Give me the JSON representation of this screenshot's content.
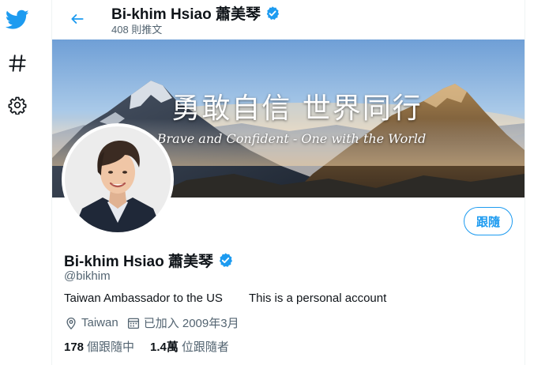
{
  "colors": {
    "accent": "#1d9bf0",
    "text": "#0f1419",
    "secondary": "#536471",
    "border": "#eff3f4"
  },
  "nav": {
    "items": [
      {
        "icon": "twitter-bird-icon"
      },
      {
        "icon": "hashtag-icon"
      },
      {
        "icon": "gear-icon"
      }
    ]
  },
  "header": {
    "back_icon": "arrow-left-icon",
    "name": "Bi-khim Hsiao 蕭美琴",
    "tweet_count": "408 則推文"
  },
  "banner": {
    "title": "勇敢自信 世界同行",
    "subtitle": "Brave and Confident - One with the World"
  },
  "profile": {
    "name": "Bi-khim Hsiao 蕭美琴",
    "handle": "@bikhim",
    "bio": "Taiwan Ambassador to the US        This is a personal account",
    "location": "Taiwan",
    "joined": "已加入 2009年3月",
    "follow_label": "跟隨",
    "stats": {
      "following_count": "178",
      "following_label": "個跟隨中",
      "followers_count": "1.4萬",
      "followers_label": "位跟隨者"
    }
  }
}
